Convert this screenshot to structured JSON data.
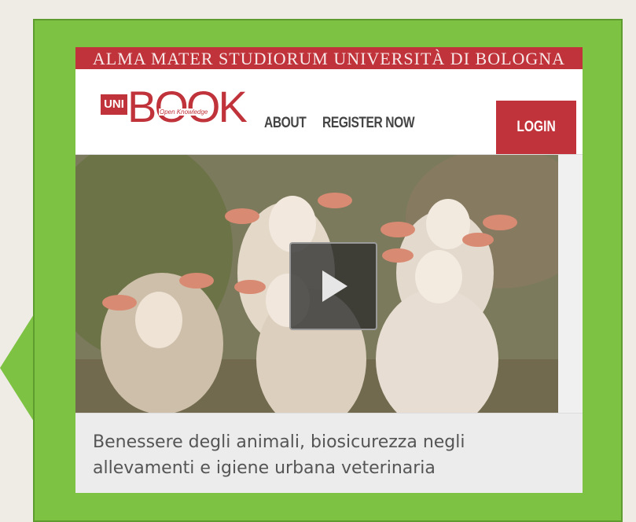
{
  "university_bar": {
    "text": "ALMA MATER STUDIORUM UNIVERSITÀ DI BOLOGNA"
  },
  "logo": {
    "uni": "UNI",
    "book": "BOOK",
    "tagline": "Open Knowledge"
  },
  "nav": {
    "about": "ABOUT",
    "register": "REGISTER NOW",
    "login": "LOGIN"
  },
  "video": {
    "play_icon": "play-icon"
  },
  "caption": {
    "title": "Benessere degli animali, biosicurezza negli allevamenti e igiene urbana veterinaria"
  },
  "colors": {
    "frame_green": "#7dc242",
    "brand_red": "#c0333a"
  }
}
